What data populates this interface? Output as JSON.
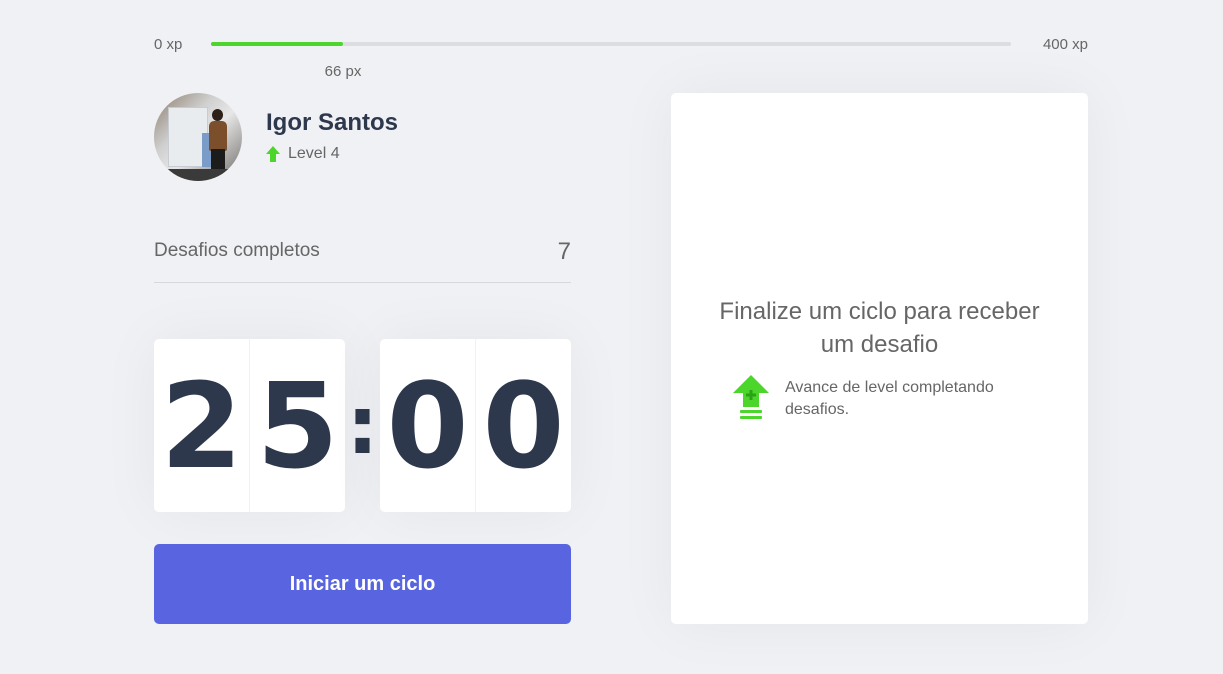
{
  "xp": {
    "min_label": "0 xp",
    "max_label": "400 xp",
    "current_label": "66 px",
    "current_fraction": 0.165
  },
  "profile": {
    "name": "Igor Santos",
    "level_label": "Level 4"
  },
  "completed": {
    "label": "Desafios completos",
    "count": "7"
  },
  "countdown": {
    "minute_left": "2",
    "minute_right": "5",
    "separator": ":",
    "second_left": "0",
    "second_right": "0"
  },
  "start_button": {
    "label": "Iniciar um ciclo"
  },
  "challenge": {
    "title": "Finalize um ciclo para receber um desafio",
    "hint": "Avance de level completando desafios."
  },
  "colors": {
    "background": "#f0f1f4",
    "accent": "#5965e0",
    "xp_green": "#4cd62b",
    "title_dark": "#2e384d",
    "text": "#666666"
  },
  "icons": {
    "level": "level-up-arrow-icon",
    "hint": "level-up-icon"
  }
}
